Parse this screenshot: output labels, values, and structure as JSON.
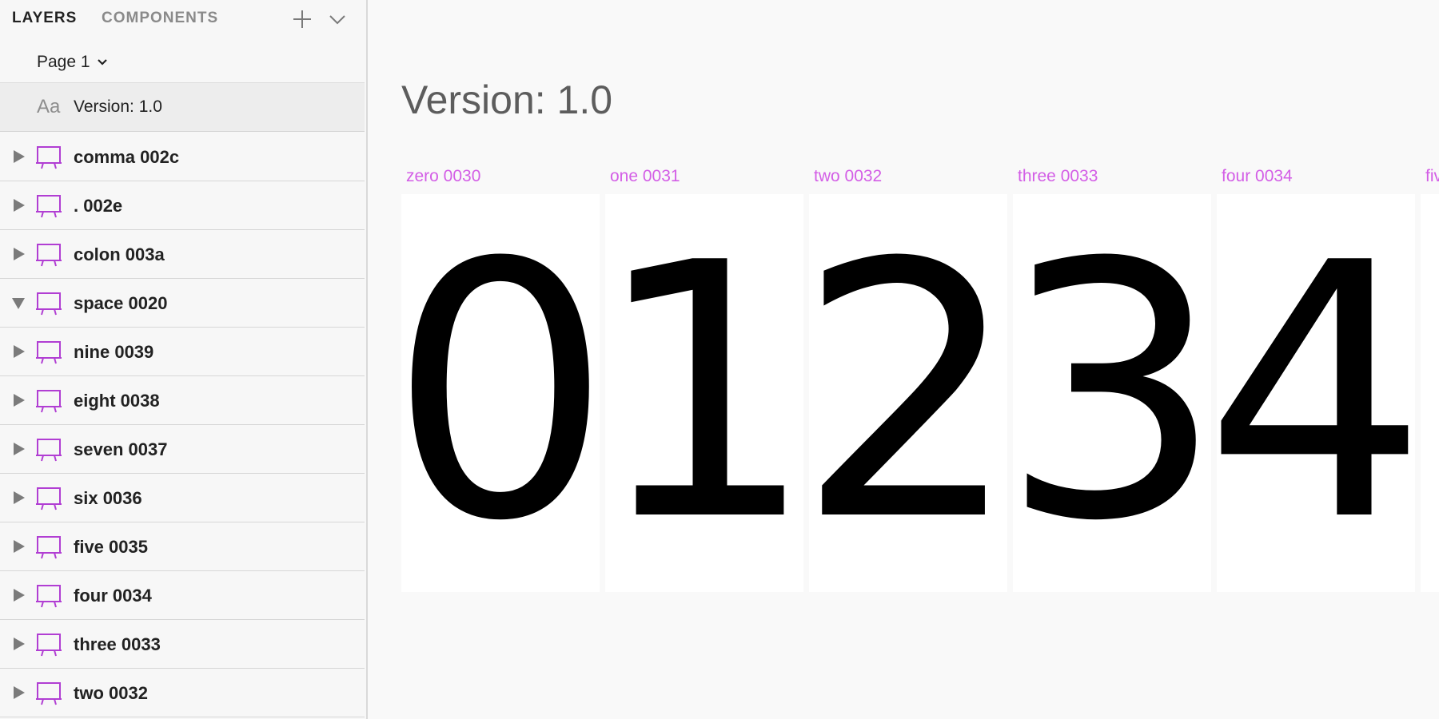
{
  "sidebar": {
    "tabs": {
      "layers": "LAYERS",
      "components": "COMPONENTS"
    },
    "page_selector": "Page 1",
    "text_layer": {
      "icon": "Aa",
      "label": "Version: 1.0"
    },
    "layers": [
      {
        "label": "comma 002c",
        "expanded": false
      },
      {
        "label": ". 002e",
        "expanded": false
      },
      {
        "label": "colon 003a",
        "expanded": false
      },
      {
        "label": "space 0020",
        "expanded": true
      },
      {
        "label": "nine 0039",
        "expanded": false
      },
      {
        "label": "eight 0038",
        "expanded": false
      },
      {
        "label": "seven 0037",
        "expanded": false
      },
      {
        "label": "six 0036",
        "expanded": false
      },
      {
        "label": "five 0035",
        "expanded": false
      },
      {
        "label": "four 0034",
        "expanded": false
      },
      {
        "label": "three 0033",
        "expanded": false
      },
      {
        "label": "two 0032",
        "expanded": false
      }
    ]
  },
  "canvas": {
    "title": "Version: 1.0",
    "artboards": [
      {
        "label": "zero 0030",
        "glyph": "0"
      },
      {
        "label": "one 0031",
        "glyph": "1"
      },
      {
        "label": "two 0032",
        "glyph": "2"
      },
      {
        "label": "three 0033",
        "glyph": "3"
      },
      {
        "label": "four 0034",
        "glyph": "4"
      },
      {
        "label": "fiv",
        "glyph": ""
      }
    ]
  },
  "colors": {
    "artboard_label": "#d35ee6",
    "artboard_icon": "#b13ed3",
    "selected_row": "#ededed"
  },
  "icons": {
    "add": "plus-icon",
    "options": "chevron-down-icon",
    "page_dropdown": "chevron-down-icon",
    "text_layer": "text-layer-icon",
    "artboard": "artboard-icon",
    "collapsed": "triangle-right-icon",
    "expanded": "triangle-down-icon"
  }
}
